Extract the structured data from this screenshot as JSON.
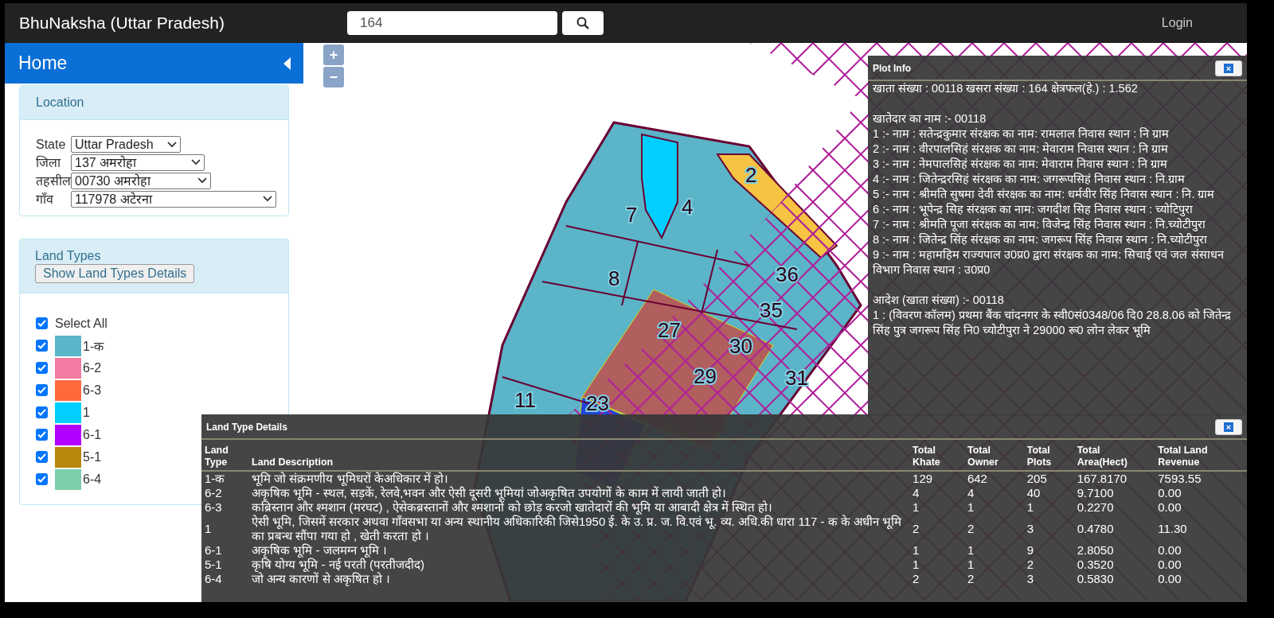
{
  "header": {
    "title": "BhuNaksha (Uttar Pradesh)",
    "search_value": "164",
    "login": "Login"
  },
  "sidebar": {
    "home": "Home",
    "location": {
      "title": "Location",
      "fields": [
        {
          "label": "State",
          "value": "Uttar Pradesh"
        },
        {
          "label": "जिला",
          "value": "137 अमरोहा"
        },
        {
          "label": "तहसील",
          "value": "00730 अमरोहा"
        },
        {
          "label": "गाँव",
          "value": "117978 अटेरना"
        }
      ]
    },
    "land_types": {
      "title": "Land Types",
      "details_button": "Show Land Types Details",
      "select_all": {
        "label": "Select All",
        "checked": true
      },
      "items": [
        {
          "label": "1-क",
          "color": "#5bb4c8",
          "checked": true
        },
        {
          "label": "6-2",
          "color": "#f47aa2",
          "checked": true
        },
        {
          "label": "6-3",
          "color": "#ff6a3d",
          "checked": true
        },
        {
          "label": "1",
          "color": "#00cfff",
          "checked": true
        },
        {
          "label": "6-1",
          "color": "#b200ff",
          "checked": true
        },
        {
          "label": "5-1",
          "color": "#b8860b",
          "checked": true
        },
        {
          "label": "6-4",
          "color": "#7dcfaa",
          "checked": true
        }
      ]
    }
  },
  "map": {
    "zoom_in": "+",
    "zoom_out": "−",
    "parcel_labels": [
      "4",
      "2",
      "7",
      "8",
      "36",
      "35",
      "27",
      "30",
      "29",
      "31",
      "11",
      "23"
    ]
  },
  "plot_info": {
    "title": "Plot Info",
    "close": "×",
    "summary": "खाता संख्या : 00118 खसरा संख्या : 164 क्षेत्रफल(हे.) : 1.562",
    "owners_heading": "खातेदार का नाम :- 00118",
    "owners": [
      "1 :- नाम : सतेन्द्रकुमार संरक्षक का नाम: रामलाल निवास स्थान : नि ग्राम",
      "2 :- नाम : वीरपालसिहं संरक्षक का नाम: मेवाराम निवास स्थान : नि ग्राम",
      "3 :- नाम : नेमपालसिहं संरक्षक का नाम: मेवाराम निवास स्थान : नि ग्राम",
      "4 :- नाम : जितेन्द्ररसिहं संरक्षक का नाम: जगरूपसिहं निवास स्थान : नि.ग्राम",
      "5 :- नाम : श्रीमति सुषमा देवी संरक्षक का नाम: धर्मवीर सिंह निवास स्थान : नि. ग्राम",
      "6 :- नाम : भूपेन्द्र सिह संरक्षक का नाम: जगदीश सिह निवास स्थान : च्योटिपुरा",
      "7 :- नाम : श्रीमति पूजा संरक्षक का नाम: विजेन्द्र सिंह निवास स्थान : नि.च्योटीपुरा",
      "8 :- नाम : जितेन्द्र सिंह संरक्षक का नाम: जगरूप सिंह निवास स्थान : नि.च्योटीपुरा",
      "9 :- नाम : महामहिम राज्यपाल उ0प्र0 द्वारा संरक्षक का नाम: सिचाई एवं जल संसाधन विभाग निवास स्थान : उ0प्र0"
    ],
    "orders_heading": "आदेश (खाता संख्या) :- 00118",
    "orders": [
      "1 : (विवरण कॉलम) प्रथमा बैंक चांदनगर के स्वी0सं0348/06 दि0 28.8.06 को जितेन्द्र सिंह पुत्र जगरूप सिंह नि0 च्योटीपुरा ने 29000 रू0 लोन लेकर भूमि"
    ]
  },
  "land_type_details": {
    "title": "Land Type Details",
    "close": "×",
    "columns": [
      "Land Type",
      "Land Description",
      "Total Khate",
      "Total Owner",
      "Total Plots",
      "Total Area(Hect)",
      "Total Land Revenue"
    ],
    "rows": [
      [
        "1-क",
        "भूमि जो संक्रमणीय भूमिधरों केअधिकार में हो।",
        "129",
        "642",
        "205",
        "167.8170",
        "7593.55"
      ],
      [
        "6-2",
        "अकृषिक भूमि - स्थल, सड़कें, रेलवे,भवन और ऐसी दूसरी भूमियां जोअकृषित उपयोगों के काम में लायी जाती हो।",
        "4",
        "4",
        "40",
        "9.7100",
        "0.00"
      ],
      [
        "6-3",
        "कब्रिस्तान और श्मशान (मरघट) , ऐसेकब्रस्तानों और श्मशानों को छोड़ करजो खातेदारों की भूमि या आबादी क्षेत्र में स्थित हो।",
        "1",
        "1",
        "1",
        "0.2270",
        "0.00"
      ],
      [
        "1",
        "ऐसी भूमि, जिसमें सरकार अथवा गाँवसभा या अन्य स्थानीय अधिकारिकी जिसे1950 ई. के उ. प्र. ज. वि.एवं भू. व्य. अधि.की धारा 117 - क के अधीन भूमि का प्रबन्ध सौंपा गया हो , खेती करता हो ।",
        "2",
        "2",
        "3",
        "0.4780",
        "11.30"
      ],
      [
        "6-1",
        "अकृषिक भूमि - जलमग्न भूमि ।",
        "1",
        "1",
        "9",
        "2.8050",
        "0.00"
      ],
      [
        "5-1",
        "कृषि योग्य भूमि - नई परती (परतीजदीद)",
        "1",
        "1",
        "2",
        "0.3520",
        "0.00"
      ],
      [
        "6-4",
        "जो अन्य कारणों से अकृषित हो ।",
        "2",
        "2",
        "3",
        "0.5830",
        "0.00"
      ]
    ]
  }
}
